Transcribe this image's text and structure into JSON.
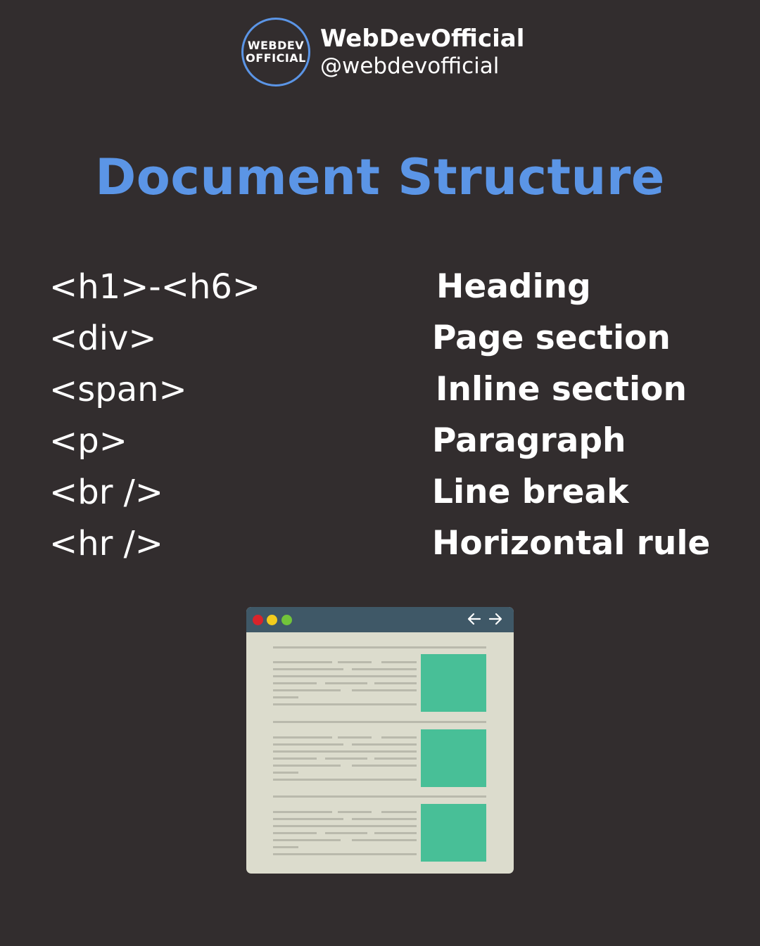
{
  "brand": {
    "logo_line1": "WEBDEV",
    "logo_line2": "OFFICIAL",
    "name": "WebDevOfficial",
    "handle": "@webdevofficial"
  },
  "title": "Document Structure",
  "rows": [
    {
      "tag": "<h1>-<h6>",
      "desc": "Heading"
    },
    {
      "tag": "<div>",
      "desc": "Page section"
    },
    {
      "tag": "<span>",
      "desc": "Inline section"
    },
    {
      "tag": "<p>",
      "desc": "Paragraph"
    },
    {
      "tag": "<br />",
      "desc": "Line break"
    },
    {
      "tag": "<hr />",
      "desc": "Horizontal rule"
    }
  ],
  "colors": {
    "background": "#322d2e",
    "accent": "#5b95e6",
    "browser_bar": "#3f5867",
    "browser_page": "#dcdccd",
    "image_block": "#48bf97"
  },
  "icons": [
    "back-arrow-icon",
    "forward-arrow-icon"
  ]
}
